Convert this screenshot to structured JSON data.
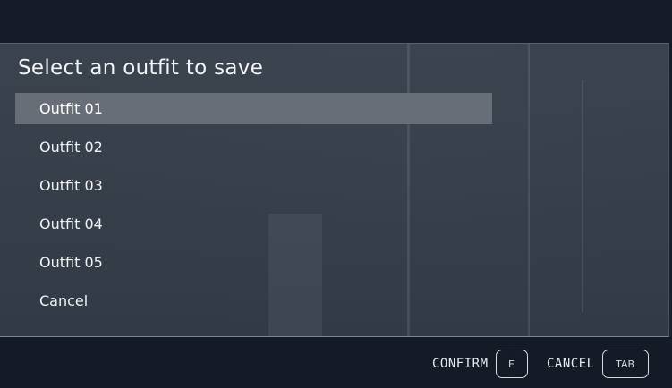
{
  "dialog": {
    "title": "Select an outfit to save",
    "selected_index": 0,
    "options": [
      {
        "label": "Outfit 01"
      },
      {
        "label": "Outfit 02"
      },
      {
        "label": "Outfit 03"
      },
      {
        "label": "Outfit 04"
      },
      {
        "label": "Outfit 05"
      },
      {
        "label": "Cancel"
      }
    ]
  },
  "controls": {
    "confirm": {
      "label": "CONFIRM",
      "key": "E"
    },
    "cancel": {
      "label": "CANCEL",
      "key": "TAB"
    }
  },
  "colors": {
    "panel": "#3e4652",
    "selected_row": "#686e77",
    "bars": "#141b27",
    "text": "#f1f3f5"
  }
}
